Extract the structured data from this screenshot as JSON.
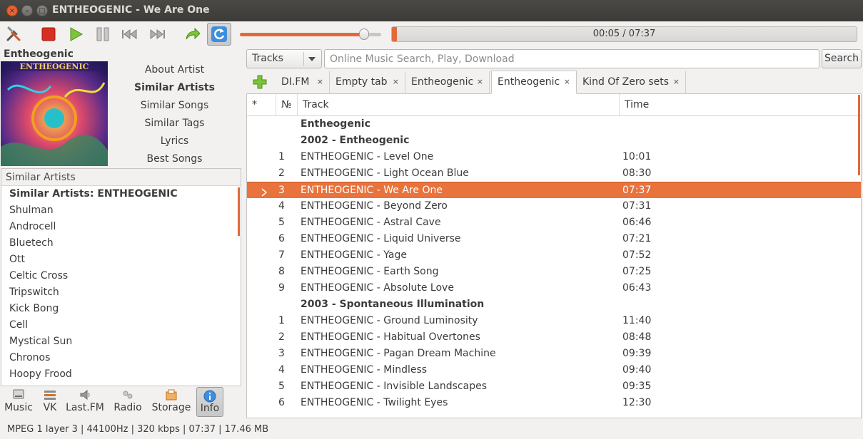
{
  "window": {
    "title": "ENTHEOGENIC - We Are One",
    "close_glyph": "×",
    "minimize_glyph": "–",
    "maximize_glyph": "□"
  },
  "player": {
    "volume_fraction": 0.88,
    "progress_fraction": 0.011,
    "time_display": "00:05 / 07:37"
  },
  "left": {
    "artist_title": "Entheogenic",
    "info_links": [
      {
        "label": "About Artist",
        "bold": false
      },
      {
        "label": "Similar Artists",
        "bold": true
      },
      {
        "label": "Similar Songs",
        "bold": false
      },
      {
        "label": "Similar Tags",
        "bold": false
      },
      {
        "label": "Lyrics",
        "bold": false
      },
      {
        "label": "Best Songs",
        "bold": false
      }
    ],
    "panel_header": "Similar Artists",
    "similar_heading": "Similar Artists: ENTHEOGENIC",
    "similar_artists": [
      "Shulman",
      "Androcell",
      "Bluetech",
      "Ott",
      "Celtic Cross",
      "Tripswitch",
      "Kick Bong",
      "Cell",
      "Mystical Sun",
      "Chronos",
      "Hoopy Frood"
    ]
  },
  "modes": [
    {
      "label": "Music",
      "icon": "hard-drive-icon",
      "active": false
    },
    {
      "label": "VK",
      "icon": "vk-icon",
      "active": false
    },
    {
      "label": "Last.FM",
      "icon": "lastfm-icon",
      "active": false
    },
    {
      "label": "Radio",
      "icon": "radio-icon",
      "active": false
    },
    {
      "label": "Storage",
      "icon": "storage-icon",
      "active": false
    },
    {
      "label": "Info",
      "icon": "info-icon",
      "active": true
    }
  ],
  "search": {
    "combo_value": "Tracks",
    "placeholder": "Online Music Search, Play, Download",
    "button_label": "Search"
  },
  "tabs": [
    {
      "label": "DI.FM",
      "active": false
    },
    {
      "label": "Empty tab",
      "active": false
    },
    {
      "label": "Entheogenic",
      "active": false
    },
    {
      "label": "Entheogenic",
      "active": true
    },
    {
      "label": "Kind Of Zero sets",
      "active": false
    }
  ],
  "tab_close_glyph": "×",
  "playlist": {
    "columns": {
      "star": "*",
      "num": "№",
      "track": "Track",
      "time": "Time"
    },
    "rows": [
      {
        "type": "group",
        "track": "Entheogenic",
        "num": "",
        "time": ""
      },
      {
        "type": "group",
        "track": "2002 - Entheogenic",
        "num": "",
        "time": ""
      },
      {
        "type": "track",
        "num": "1",
        "track": "ENTHEOGENIC - Level One",
        "time": "10:01"
      },
      {
        "type": "track",
        "num": "2",
        "track": "ENTHEOGENIC - Light Ocean Blue",
        "time": "08:30"
      },
      {
        "type": "playing",
        "num": "3",
        "track": "ENTHEOGENIC - We Are One",
        "time": "07:37"
      },
      {
        "type": "track",
        "num": "4",
        "track": "ENTHEOGENIC - Beyond Zero",
        "time": "07:31"
      },
      {
        "type": "track",
        "num": "5",
        "track": "ENTHEOGENIC - Astral Cave",
        "time": "06:46"
      },
      {
        "type": "track",
        "num": "6",
        "track": "ENTHEOGENIC - Liquid Universe",
        "time": "07:21"
      },
      {
        "type": "track",
        "num": "7",
        "track": "ENTHEOGENIC - Yage",
        "time": "07:52"
      },
      {
        "type": "track",
        "num": "8",
        "track": "ENTHEOGENIC - Earth Song",
        "time": "07:25"
      },
      {
        "type": "track",
        "num": "9",
        "track": "ENTHEOGENIC - Absolute Love",
        "time": "06:43"
      },
      {
        "type": "group",
        "track": "2003 - Spontaneous Illumination",
        "num": "",
        "time": ""
      },
      {
        "type": "track",
        "num": "1",
        "track": "ENTHEOGENIC - Ground Luminosity",
        "time": "11:40"
      },
      {
        "type": "track",
        "num": "2",
        "track": "ENTHEOGENIC - Habitual Overtones",
        "time": "08:48"
      },
      {
        "type": "track",
        "num": "3",
        "track": "ENTHEOGENIC - Pagan Dream Machine",
        "time": "09:39"
      },
      {
        "type": "track",
        "num": "4",
        "track": "ENTHEOGENIC - Mindless",
        "time": "09:40"
      },
      {
        "type": "track",
        "num": "5",
        "track": "ENTHEOGENIC - Invisible Landscapes",
        "time": "09:35"
      },
      {
        "type": "track",
        "num": "6",
        "track": "ENTHEOGENIC - Twilight Eyes",
        "time": "12:30"
      }
    ]
  },
  "status": {
    "text": "MPEG 1 layer 3 | 44100Hz | 320 kbps | 07:37 | 17.46 MB"
  },
  "colors": {
    "accent": "#e8733d",
    "titlebar": "#3c3b37",
    "window_bg": "#f2f1f0"
  }
}
